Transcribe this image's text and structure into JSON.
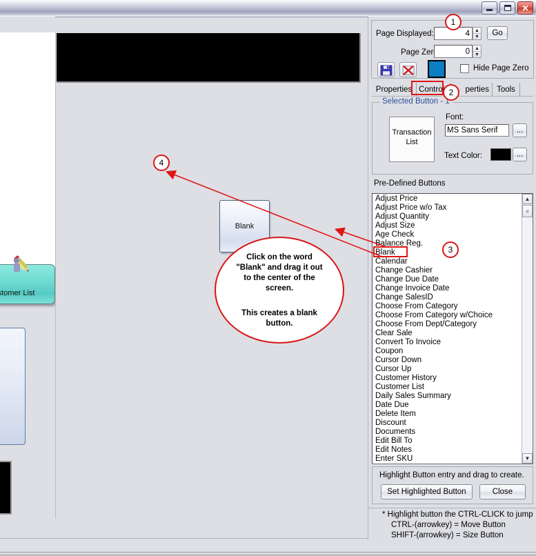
{
  "window": {
    "minimize_label": "Minimize",
    "maximize_label": "Maximize",
    "close_label": "Close"
  },
  "panel": {
    "page_displayed_label": "Page Displayed:",
    "page_displayed_value": "4",
    "go_label": "Go",
    "page_zero_label": "Page Zero:",
    "page_zero_value": "0",
    "save_icon": "floppy-disk-icon",
    "delete_icon": "red-x-icon",
    "color_swatch": "#0b7ec4",
    "hide_page_zero_label": "Hide Page Zero",
    "hide_page_zero_checked": false
  },
  "tabs": [
    {
      "label": "Properties",
      "active": false
    },
    {
      "label": "Controls",
      "active": true
    },
    {
      "label": "perties",
      "active": false
    },
    {
      "label": "Tools",
      "active": false
    }
  ],
  "selected_button": {
    "group_label": "Selected Button - 1",
    "preview_line1": "Transaction",
    "preview_line2": "List",
    "font_label": "Font:",
    "font_value": "MS Sans Serif",
    "font_browse_label": "...",
    "text_color_label": "Text Color:",
    "text_color_value": "#000000",
    "text_color_browse_label": "..."
  },
  "predefined": {
    "header": "Pre-Defined Buttons",
    "selected_item": "Blank",
    "items": [
      "Adjust Price",
      "Adjust Price w/o Tax",
      "Adjust Quantity",
      "Adjust Size",
      "Age Check",
      "Balance Reg.",
      "Blank",
      "Calendar",
      "Change Cashier",
      "Change Due Date",
      "Change Invoice Date",
      "Change SalesID",
      "Choose From Category",
      "Choose From Category w/Choice",
      "Choose From Dept/Category",
      "Clear Sale",
      "Convert To Invoice",
      "Coupon",
      "Cursor Down",
      "Cursor Up",
      "Customer History",
      "Customer List",
      "Daily Sales Summary",
      "Date Due",
      "Delete Item",
      "Discount",
      "Documents",
      "Edit Bill To",
      "Edit Notes",
      "Enter SKU"
    ],
    "scroll_up_icon": "chevron-up-icon",
    "scroll_down_icon": "chevron-down-icon"
  },
  "footer": {
    "hint": "Highlight Button entry and drag to create.",
    "set_highlighted_label": "Set Highlighted Button",
    "close_label": "Close",
    "tip1": "* Highlight button the CTRL-CLICK to jump",
    "tip2": "CTRL-(arrowkey) = Move Button",
    "tip3": "SHIFT-(arrowkey) = Size Button"
  },
  "canvas": {
    "blank_button_label": "Blank",
    "customer_list_label": "ustomer List",
    "customer_list_icon": "pencil-icon"
  },
  "annotations": {
    "callout_text": "Click on the word\n\"Blank\" and drag it out\nto the center of the\nscreen.",
    "callout_text2": "This creates a blank\nbutton.",
    "marker1": "1",
    "marker2": "2",
    "marker3": "3",
    "marker4": "4",
    "highlight_color": "#d81616"
  }
}
